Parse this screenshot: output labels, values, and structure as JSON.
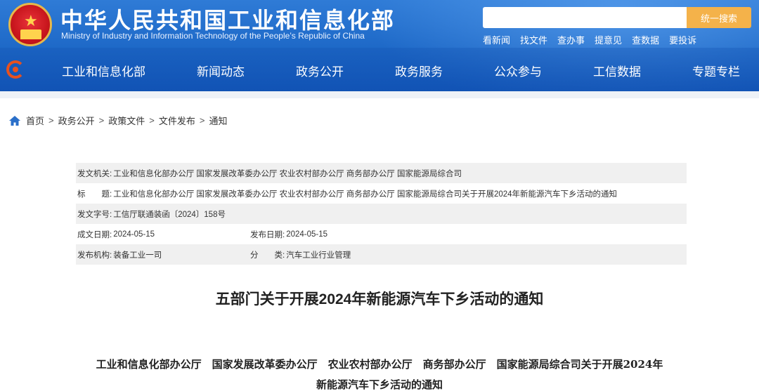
{
  "header": {
    "title": "中华人民共和国工业和信息化部",
    "subtitle": "Ministry of Industry and Information Technology of the People’s Republic of China",
    "search": {
      "placeholder": "",
      "button_label": "统一搜索"
    },
    "quick_links": [
      "看新闻",
      "找文件",
      "查办事",
      "提意见",
      "查数据",
      "要投诉"
    ],
    "colors": {
      "brand_blue": "#1d68c7",
      "search_button": "#f4b24a",
      "emblem_red": "#c8161d"
    }
  },
  "nav": {
    "items": [
      "工业和信息化部",
      "新闻动态",
      "政务公开",
      "政务服务",
      "公众参与",
      "工信数据",
      "专题专栏"
    ]
  },
  "breadcrumb": {
    "icon": "home-icon",
    "items": [
      "首页",
      "政务公开",
      "政策文件",
      "文件发布",
      "通知"
    ]
  },
  "info": {
    "issuer_label": "发文机关:",
    "issuer": "工业和信息化部办公厅 国家发展改革委办公厅 农业农村部办公厅 商务部办公厅 国家能源局综合司",
    "title_label": "标　　题:",
    "title": "工业和信息化部办公厅 国家发展改革委办公厅 农业农村部办公厅 商务部办公厅 国家能源局综合司关于开展2024年新能源汽车下乡活动的通知",
    "doc_no_label": "发文字号:",
    "doc_no": "工信厅联通装函〔2024〕158号",
    "created_label": "成文日期:",
    "created": "2024-05-15",
    "published_label": "发布日期:",
    "published": "2024-05-15",
    "org_label": "发布机构:",
    "org": "装备工业一司",
    "category_label": "分　　类:",
    "category": "汽车工业行业管理"
  },
  "article": {
    "title": "五部门关于开展2024年新能源汽车下乡活动的通知",
    "subtitle_line1": "工业和信息化部办公厅　国家发展改革委办公厅　农业农村部办公厅　商务部办公厅　国家能源局综合司关于开展2024年",
    "subtitle_line2": "新能源汽车下乡活动的通知"
  }
}
